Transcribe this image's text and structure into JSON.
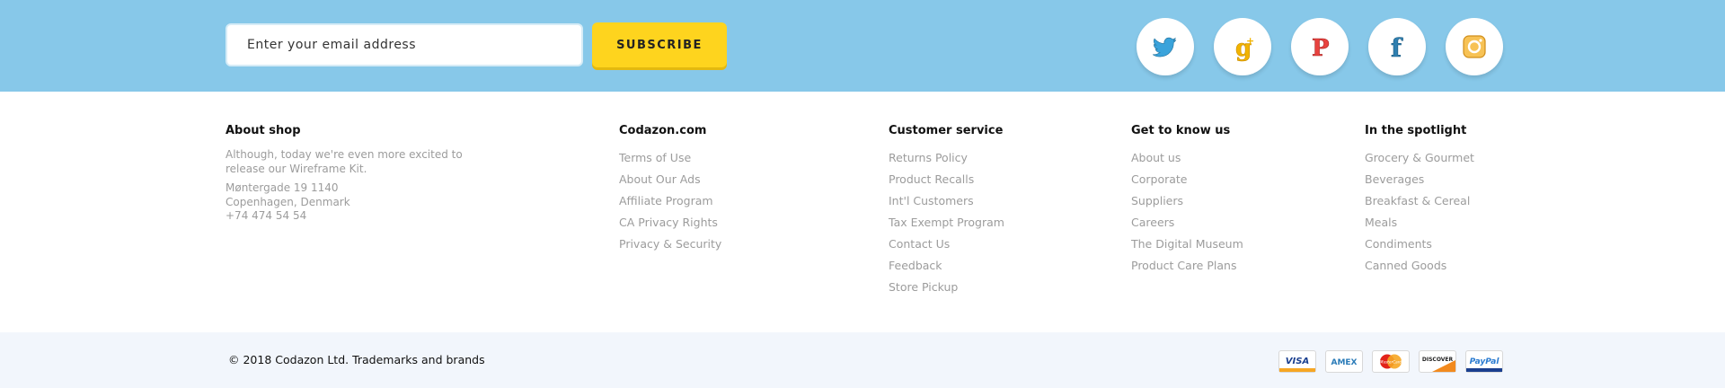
{
  "newsletter": {
    "email_placeholder": "Enter your email address",
    "subscribe_label": "SUBSCRIBE"
  },
  "social": [
    {
      "icon": "twitter-icon",
      "color": "#3aa3db"
    },
    {
      "icon": "google-plus-icon",
      "color": "#f2b400"
    },
    {
      "icon": "pinterest-icon",
      "color": "#e8423f"
    },
    {
      "icon": "facebook-icon",
      "color": "#2f7fb0"
    },
    {
      "icon": "instagram-icon",
      "color": "#f5b03c"
    }
  ],
  "footer": {
    "about": {
      "title": "About shop",
      "text": "Although, today we're even more excited to release our Wireframe Kit.",
      "address_line1": "Møntergade 19 1140",
      "address_line2": "Copenhagen, Denmark",
      "phone": "+74 474 54 54"
    },
    "columns": [
      {
        "title": "Codazon.com",
        "links": [
          "Terms of Use",
          "About Our Ads",
          "Affiliate Program",
          "CA Privacy Rights",
          "Privacy & Security"
        ]
      },
      {
        "title": "Customer service",
        "links": [
          "Returns Policy",
          "Product Recalls",
          "Int'l Customers",
          "Tax Exempt Program",
          "Contact Us",
          "Feedback",
          "Store Pickup"
        ]
      },
      {
        "title": "Get to know us",
        "links": [
          "About us",
          "Corporate",
          "Suppliers",
          "Careers",
          "The Digital Museum",
          "Product Care Plans"
        ]
      },
      {
        "title": "In the spotlight",
        "links": [
          "Grocery & Gourmet",
          "Beverages",
          "Breakfast & Cereal",
          "Meals",
          "Condiments",
          "Canned Goods"
        ]
      }
    ]
  },
  "bottom": {
    "copyright": "© 2018 Codazon Ltd. Trademarks and brands",
    "payments": [
      {
        "name": "VISA",
        "icon": "visa-icon"
      },
      {
        "name": "AMEX",
        "icon": "amex-icon"
      },
      {
        "name": "MasterCard",
        "icon": "mastercard-icon"
      },
      {
        "name": "DISCOVER",
        "icon": "discover-icon"
      },
      {
        "name": "PayPal",
        "icon": "paypal-icon"
      }
    ]
  }
}
